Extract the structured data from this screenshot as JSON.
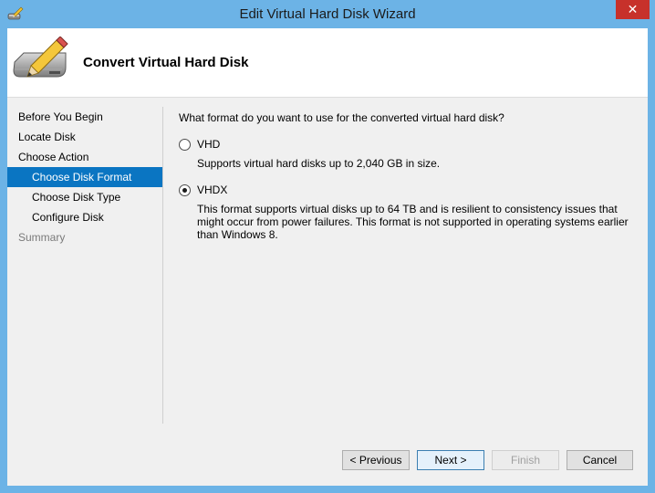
{
  "window": {
    "title": "Edit Virtual Hard Disk Wizard",
    "close_glyph": "✕",
    "icon": "pencil-disk-icon"
  },
  "header": {
    "title": "Convert Virtual Hard Disk",
    "icon": "pencil-disk-icon"
  },
  "nav": {
    "items": [
      {
        "label": "Before You Begin",
        "state": "normal"
      },
      {
        "label": "Locate Disk",
        "state": "normal"
      },
      {
        "label": "Choose Action",
        "state": "normal"
      },
      {
        "label": "Choose Disk Format",
        "state": "selected"
      },
      {
        "label": "Choose Disk Type",
        "state": "normal"
      },
      {
        "label": "Configure Disk",
        "state": "normal"
      },
      {
        "label": "Summary",
        "state": "disabled"
      }
    ]
  },
  "content": {
    "question": "What format do you want to use for the converted virtual hard disk?",
    "options": [
      {
        "label": "VHD",
        "checked": false,
        "description": "Supports virtual hard disks up to 2,040 GB in size."
      },
      {
        "label": "VHDX",
        "checked": true,
        "description": "This format supports virtual disks up to 64 TB and is resilient to consistency issues that might occur from power failures. This format is not supported in operating systems earlier than Windows 8."
      }
    ]
  },
  "buttons": {
    "previous": "< Previous",
    "next": "Next >",
    "finish": "Finish",
    "cancel": "Cancel"
  },
  "colors": {
    "titlebar": "#6cb3e6",
    "selected_nav": "#0a75c2",
    "close": "#c7312b"
  }
}
